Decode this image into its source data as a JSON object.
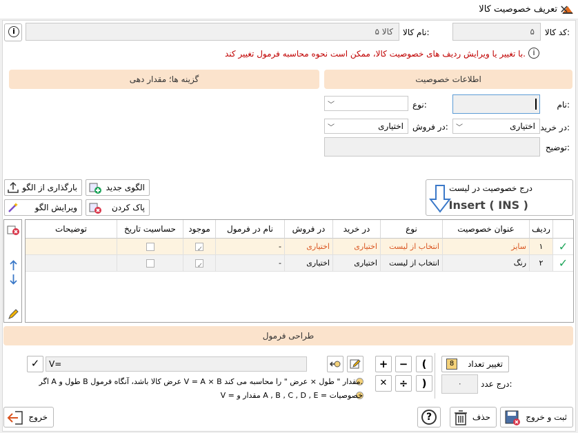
{
  "window": {
    "title": "تعریف خصوصیت کالا",
    "close_glyph": "✕"
  },
  "header": {
    "code_label": "کد کالا:",
    "code_value": "۵",
    "name_label": "نام کالا:",
    "name_value": "کالا ۵",
    "info_glyph": "i",
    "warning": "با تغییر یا ویرایش ردیف های خصوصیت کالا، ممکن است نحوه محاسبه فرمول تغییر کند."
  },
  "sections": {
    "attr_info": "اطلاعات خصوصیت",
    "options": "گزینه ها؛ مقدار دهی"
  },
  "form": {
    "name_label": "نام:",
    "type_label": "نوع:",
    "buy_label": "در خرید:",
    "buy_value": "اختیاری",
    "sell_label": "در فروش:",
    "sell_value": "اختیاری",
    "desc_label": "توضیح:"
  },
  "buttons": {
    "new_pattern": "الگوی جدید",
    "load_pattern": "بارگذاری از الگو",
    "clear": "پاک کردن",
    "edit_pattern": "ویرایش الگو",
    "insert_title": "درج خصوصیت در لیست",
    "insert_key": "Insert ( INS )"
  },
  "grid": {
    "headers": [
      "ردیف",
      "عنوان خصوصیت",
      "نوع",
      "در خرید",
      "در فروش",
      "نام در فرمول",
      "موجود",
      "حساسیت تاریخ",
      "توضیحات"
    ],
    "rows": [
      {
        "idx": "۱",
        "title": "سایز",
        "type": "انتخاب از لیست",
        "buy": "اختیاری",
        "sell": "اختیاری",
        "formula": "-",
        "exists": true,
        "date": false,
        "desc": ""
      },
      {
        "idx": "۲",
        "title": "رنگ",
        "type": "انتخاب از لیست",
        "buy": "اختیاری",
        "sell": "اختیاری",
        "formula": "-",
        "exists": true,
        "date": false,
        "desc": ""
      }
    ]
  },
  "formula": {
    "head": "طراحی فرمول",
    "change_count": "تغییر تعداد",
    "count_badge": "8",
    "insert_number_label": "درج عدد:",
    "number_value": "۰",
    "input_value": "V=",
    "op_open": "(",
    "op_minus": "−",
    "op_plus": "+",
    "op_close": ")",
    "op_div": "÷",
    "op_mul": "✕",
    "hint1": "اگر A طول و B عرض کالا باشد، آنگاه فرمول V = A × B مقدار \" طول × عرض \" را محاسبه می کند.",
    "hint2": "V = مقدار و A , B , C , D , E = خصوصیات"
  },
  "footer": {
    "save_exit": "ثبت و خروج",
    "delete": "حذف",
    "help_glyph": "?",
    "exit": "خروج"
  },
  "colors": {
    "accent_orange": "#fbe3cc",
    "warn_red": "#c00000",
    "selected_row": "#fdf3e0",
    "green": "#1ea55a"
  }
}
